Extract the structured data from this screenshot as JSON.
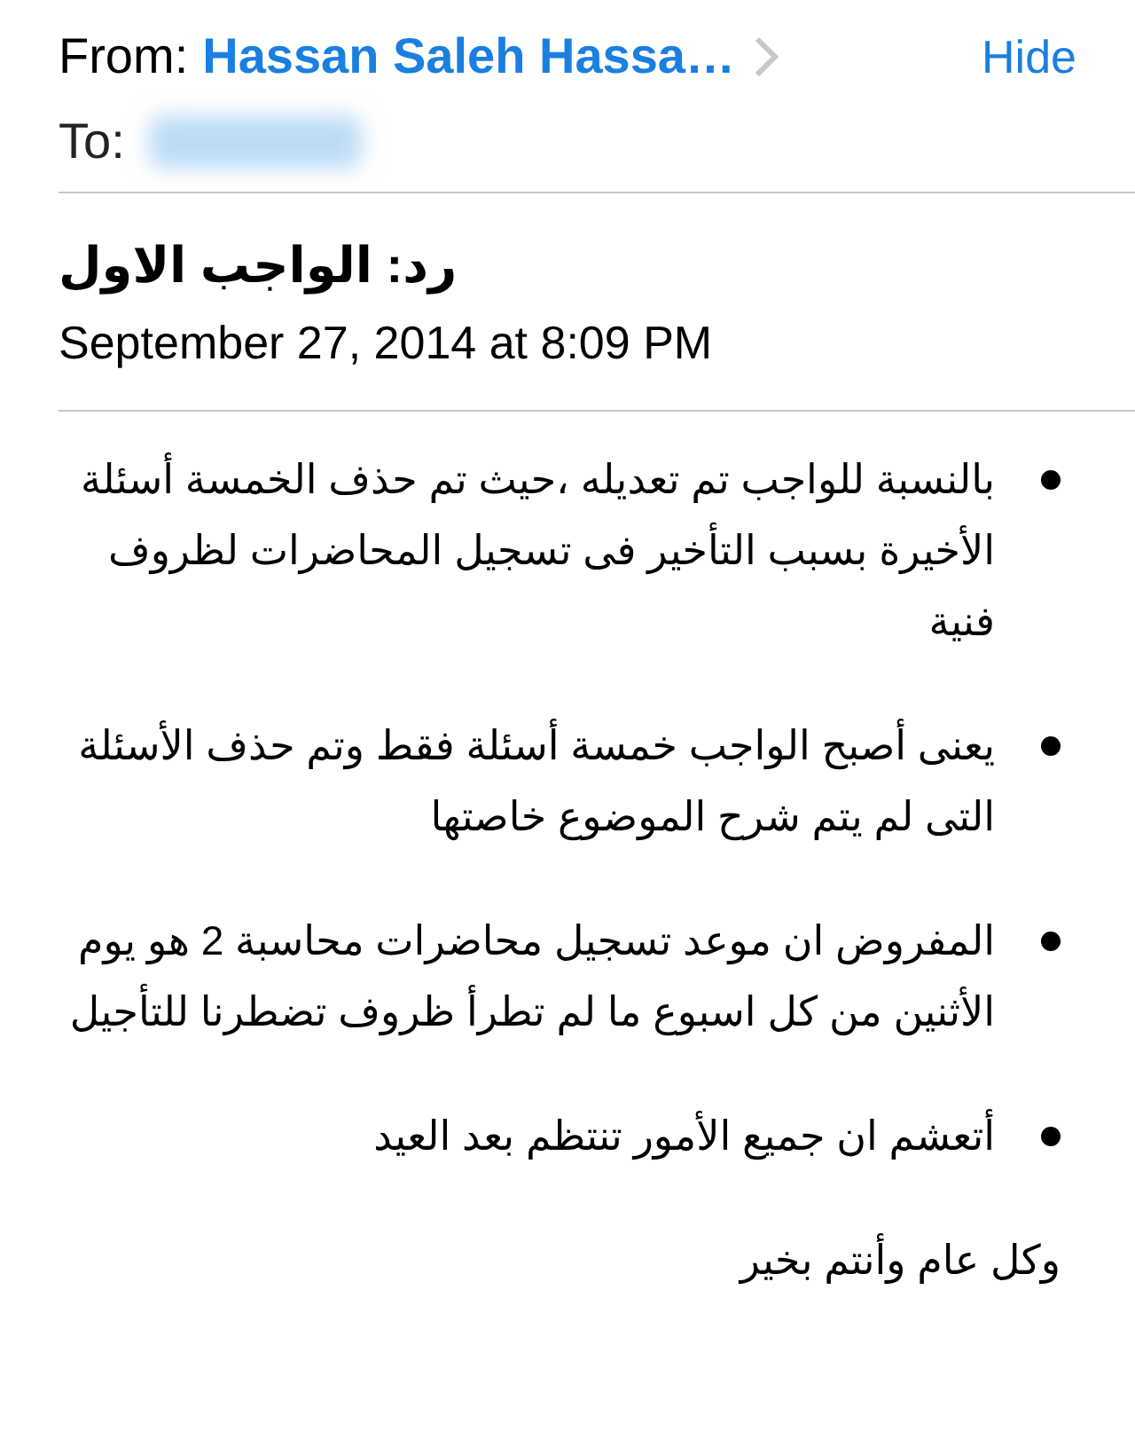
{
  "header": {
    "from_label": "From:",
    "sender": "Hassan Saleh Hassa…",
    "hide_link": "Hide",
    "to_label": "To:"
  },
  "subject": "رد: الواجب الاول",
  "date": "September 27, 2014 at 8:09 PM",
  "body": {
    "bullets": [
      "بالنسبة للواجب تم تعديله ،حيث تم حذف الخمسة أسئلة الأخيرة بسبب التأخير فى تسجيل المحاضرات لظروف فنية",
      "يعنى أصبح الواجب خمسة أسئلة فقط وتم حذف الأسئلة التى لم يتم شرح الموضوع خاصتها",
      "المفروض ان موعد تسجيل محاضرات محاسبة 2 هو يوم الأثنين من كل اسبوع ما لم تطرأ ظروف تضطرنا للتأجيل",
      "أتعشم ان جميع الأمور تنتظم بعد العيد"
    ],
    "closing": "وكل عام وأنتم بخير"
  }
}
